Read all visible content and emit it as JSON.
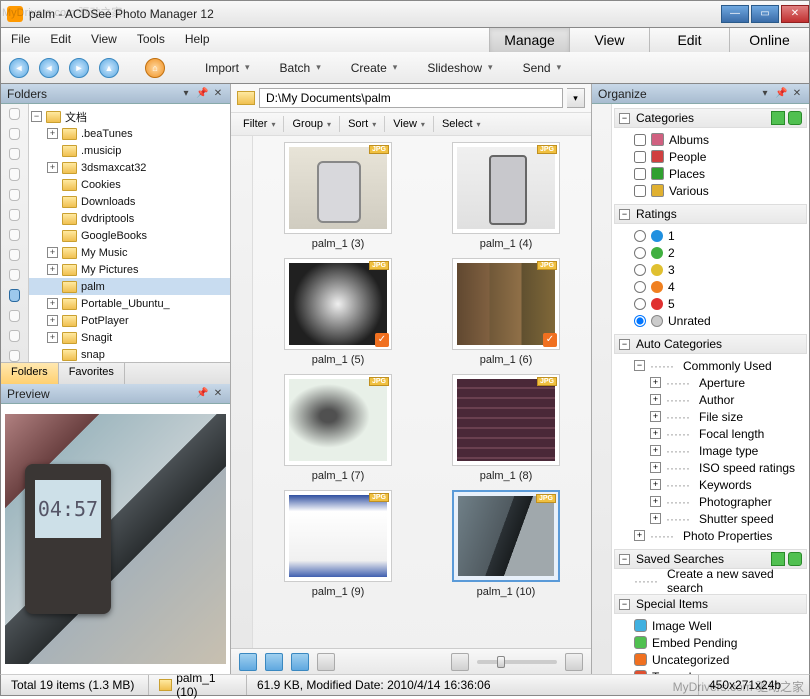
{
  "window": {
    "title": "palm - ACDSee Photo Manager 12"
  },
  "watermarks": {
    "top_left": "MyDrivers.com 驱动之家",
    "bottom_right": "MyDrivers.com 驱动之家"
  },
  "menus": [
    "File",
    "Edit",
    "View",
    "Tools",
    "Help"
  ],
  "mode_tabs": {
    "items": [
      "Manage",
      "View",
      "Edit",
      "Online"
    ],
    "active": 0
  },
  "toolbar_dropdowns": [
    "Import",
    "Batch",
    "Create",
    "Slideshow",
    "Send"
  ],
  "panels": {
    "folders": {
      "title": "Folders",
      "bottom_tabs": [
        "Folders",
        "Favorites"
      ],
      "active_tab": 0
    },
    "preview": {
      "title": "Preview",
      "phone_time": "04:57"
    },
    "organize": {
      "title": "Organize"
    }
  },
  "folder_tree": {
    "root": "文档",
    "items": [
      {
        "label": ".beaTunes",
        "expandable": true
      },
      {
        "label": ".musicip",
        "expandable": false
      },
      {
        "label": "3dsmaxcat32",
        "expandable": true
      },
      {
        "label": "Cookies",
        "expandable": false
      },
      {
        "label": "Downloads",
        "expandable": false
      },
      {
        "label": "dvdriptools",
        "expandable": false
      },
      {
        "label": "GoogleBooks",
        "expandable": false
      },
      {
        "label": "My Music",
        "expandable": true
      },
      {
        "label": "My Pictures",
        "expandable": true
      },
      {
        "label": "palm",
        "expandable": false,
        "selected": true
      },
      {
        "label": "Portable_Ubuntu_",
        "expandable": true
      },
      {
        "label": "PotPlayer",
        "expandable": true
      },
      {
        "label": "Snagit",
        "expandable": true
      },
      {
        "label": "snap",
        "expandable": false
      }
    ]
  },
  "path": "D:\\My Documents\\palm",
  "filter_bar": [
    "Filter",
    "Group",
    "Sort",
    "View",
    "Select"
  ],
  "thumbnails": [
    {
      "name": "palm_1",
      "index": 3,
      "ext": "JPG",
      "checked": false,
      "cls": "t3"
    },
    {
      "name": "palm_1",
      "index": 4,
      "ext": "JPG",
      "checked": false,
      "cls": "t4"
    },
    {
      "name": "palm_1",
      "index": 5,
      "ext": "JPG",
      "checked": true,
      "cls": "t5"
    },
    {
      "name": "palm_1",
      "index": 6,
      "ext": "JPG",
      "checked": true,
      "cls": "t6"
    },
    {
      "name": "palm_1",
      "index": 7,
      "ext": "JPG",
      "checked": false,
      "cls": "t7"
    },
    {
      "name": "palm_1",
      "index": 8,
      "ext": "JPG",
      "checked": false,
      "cls": "t8"
    },
    {
      "name": "palm_1",
      "index": 9,
      "ext": "JPG",
      "checked": false,
      "cls": "t9"
    },
    {
      "name": "palm_1",
      "index": 10,
      "ext": "JPG",
      "checked": false,
      "cls": "t10",
      "selected": true
    }
  ],
  "organize": {
    "categories": {
      "title": "Categories",
      "items": [
        {
          "label": "Albums",
          "color": "#d06080"
        },
        {
          "label": "People",
          "color": "#d04040"
        },
        {
          "label": "Places",
          "color": "#30a030"
        },
        {
          "label": "Various",
          "color": "#e0b030"
        }
      ]
    },
    "ratings": {
      "title": "Ratings",
      "items": [
        {
          "label": "1",
          "color": "#2090e0"
        },
        {
          "label": "2",
          "color": "#40b040"
        },
        {
          "label": "3",
          "color": "#e0c030"
        },
        {
          "label": "4",
          "color": "#f08020"
        },
        {
          "label": "5",
          "color": "#e03030"
        }
      ],
      "unrated_label": "Unrated"
    },
    "auto_categories": {
      "title": "Auto Categories",
      "commonly_used_label": "Commonly Used",
      "items": [
        "Aperture",
        "Author",
        "File size",
        "Focal length",
        "Image type",
        "ISO speed ratings",
        "Keywords",
        "Photographer",
        "Shutter speed"
      ],
      "photo_properties_label": "Photo Properties"
    },
    "saved_searches": {
      "title": "Saved Searches",
      "create_label": "Create a new saved search"
    },
    "special_items": {
      "title": "Special Items",
      "items": [
        {
          "label": "Image Well",
          "color": "#40b0e0"
        },
        {
          "label": "Embed Pending",
          "color": "#50c050"
        },
        {
          "label": "Uncategorized",
          "color": "#f07020"
        },
        {
          "label": "Tagged",
          "color": "#e05030"
        }
      ]
    }
  },
  "statusbar": {
    "total": "Total 19 items  (1.3 MB)",
    "selected": "palm_1 (10)",
    "details": "61.9 KB, Modified Date: 2010/4/14 16:36:06",
    "dimensions": "450x271x24b"
  }
}
